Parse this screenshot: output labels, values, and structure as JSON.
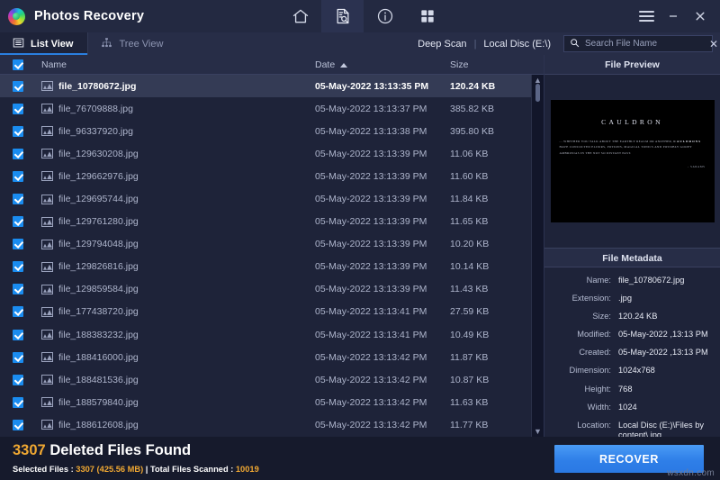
{
  "window": {
    "app_title": "Photos Recovery",
    "logo_icon": "photos-recovery-logo",
    "controls": {
      "menu": "menu-icon",
      "minimize": "–",
      "close": "✕"
    }
  },
  "toolbar": {
    "items": [
      {
        "name": "home-icon",
        "label": "Home",
        "active": false
      },
      {
        "name": "scan-document-icon",
        "label": "Scan",
        "active": true
      },
      {
        "name": "info-icon",
        "label": "Info",
        "active": false
      },
      {
        "name": "grid-icon",
        "label": "Grid",
        "active": false
      }
    ]
  },
  "tabs": [
    {
      "label": "List View",
      "icon": "list-view-icon",
      "active": true
    },
    {
      "label": "Tree View",
      "icon": "tree-view-icon",
      "active": false
    }
  ],
  "filters": {
    "scan_type": "Deep Scan",
    "divider": "|",
    "drive": "Local Disc (E:\\)",
    "search_icon": "search-icon",
    "search_value": "",
    "search_placeholder": "Search File Name",
    "clear_icon": "✕"
  },
  "table": {
    "columns": {
      "name": "Name",
      "date": "Date",
      "size": "Size"
    },
    "sort_column": "Date",
    "sort_direction": "ascending",
    "header_checkbox_checked": true,
    "rows": [
      {
        "name": "file_10780672.jpg",
        "date": "05-May-2022 13:13:35 PM",
        "size": "120.24 KB",
        "checked": true,
        "selected": true
      },
      {
        "name": "file_76709888.jpg",
        "date": "05-May-2022 13:13:37 PM",
        "size": "385.82 KB",
        "checked": true,
        "selected": false
      },
      {
        "name": "file_96337920.jpg",
        "date": "05-May-2022 13:13:38 PM",
        "size": "395.80 KB",
        "checked": true,
        "selected": false
      },
      {
        "name": "file_129630208.jpg",
        "date": "05-May-2022 13:13:39 PM",
        "size": "11.06 KB",
        "checked": true,
        "selected": false
      },
      {
        "name": "file_129662976.jpg",
        "date": "05-May-2022 13:13:39 PM",
        "size": "11.60 KB",
        "checked": true,
        "selected": false
      },
      {
        "name": "file_129695744.jpg",
        "date": "05-May-2022 13:13:39 PM",
        "size": "11.84 KB",
        "checked": true,
        "selected": false
      },
      {
        "name": "file_129761280.jpg",
        "date": "05-May-2022 13:13:39 PM",
        "size": "11.65 KB",
        "checked": true,
        "selected": false
      },
      {
        "name": "file_129794048.jpg",
        "date": "05-May-2022 13:13:39 PM",
        "size": "10.20 KB",
        "checked": true,
        "selected": false
      },
      {
        "name": "file_129826816.jpg",
        "date": "05-May-2022 13:13:39 PM",
        "size": "10.14 KB",
        "checked": true,
        "selected": false
      },
      {
        "name": "file_129859584.jpg",
        "date": "05-May-2022 13:13:39 PM",
        "size": "11.43 KB",
        "checked": true,
        "selected": false
      },
      {
        "name": "file_177438720.jpg",
        "date": "05-May-2022 13:13:41 PM",
        "size": "27.59 KB",
        "checked": true,
        "selected": false
      },
      {
        "name": "file_188383232.jpg",
        "date": "05-May-2022 13:13:41 PM",
        "size": "10.49 KB",
        "checked": true,
        "selected": false
      },
      {
        "name": "file_188416000.jpg",
        "date": "05-May-2022 13:13:42 PM",
        "size": "11.87 KB",
        "checked": true,
        "selected": false
      },
      {
        "name": "file_188481536.jpg",
        "date": "05-May-2022 13:13:42 PM",
        "size": "10.87 KB",
        "checked": true,
        "selected": false
      },
      {
        "name": "file_188579840.jpg",
        "date": "05-May-2022 13:13:42 PM",
        "size": "11.63 KB",
        "checked": true,
        "selected": false
      },
      {
        "name": "file_188612608.jpg",
        "date": "05-May-2022 13:13:42 PM",
        "size": "11.77 KB",
        "checked": true,
        "selected": false
      }
    ]
  },
  "preview": {
    "title": "File Preview",
    "image": {
      "heading": "CAULDRON",
      "body_pre": "... WHETHER YOU TALK ABOUT THE EARTHLY REALM OR ANOTHER, ",
      "body_word": "CAULDRONS",
      "body_post": " HAVE CONCOCTED ELIXIRS, POTIONS, MAGICAL TONICS AND POSSIBLY GOOEY AMBROSIAS IN THE NOT SO DISTANT PAST.",
      "signature": "- SARAMS"
    }
  },
  "metadata": {
    "title": "File Metadata",
    "fields": [
      {
        "key": "Name:",
        "value": "file_10780672.jpg"
      },
      {
        "key": "Extension:",
        "value": ".jpg"
      },
      {
        "key": "Size:",
        "value": "120.24 KB"
      },
      {
        "key": "Modified:",
        "value": "05-May-2022 ,13:13 PM"
      },
      {
        "key": "Created:",
        "value": "05-May-2022 ,13:13 PM"
      },
      {
        "key": "Dimension:",
        "value": "1024x768"
      },
      {
        "key": "Height:",
        "value": "768"
      },
      {
        "key": "Width:",
        "value": "1024"
      },
      {
        "key": "Location:",
        "value": "Local Disc (E:)\\Files by content\\.jpg"
      }
    ]
  },
  "footer": {
    "found_count": "3307",
    "found_text": "Deleted Files Found",
    "selected_label": "Selected Files : ",
    "selected_count": "3307 (425.56 MB)",
    "separator": " | ",
    "scanned_label": "Total Files Scanned : ",
    "scanned_count": "10019",
    "recover_button": "RECOVER",
    "watermark": "wsxdn.com"
  },
  "colors": {
    "accent_blue": "#2f7fe8",
    "amber": "#f0a832",
    "titlebar": "#232941",
    "panel": "#1e2339",
    "header": "#272d47",
    "selected_row": "#343b55"
  }
}
